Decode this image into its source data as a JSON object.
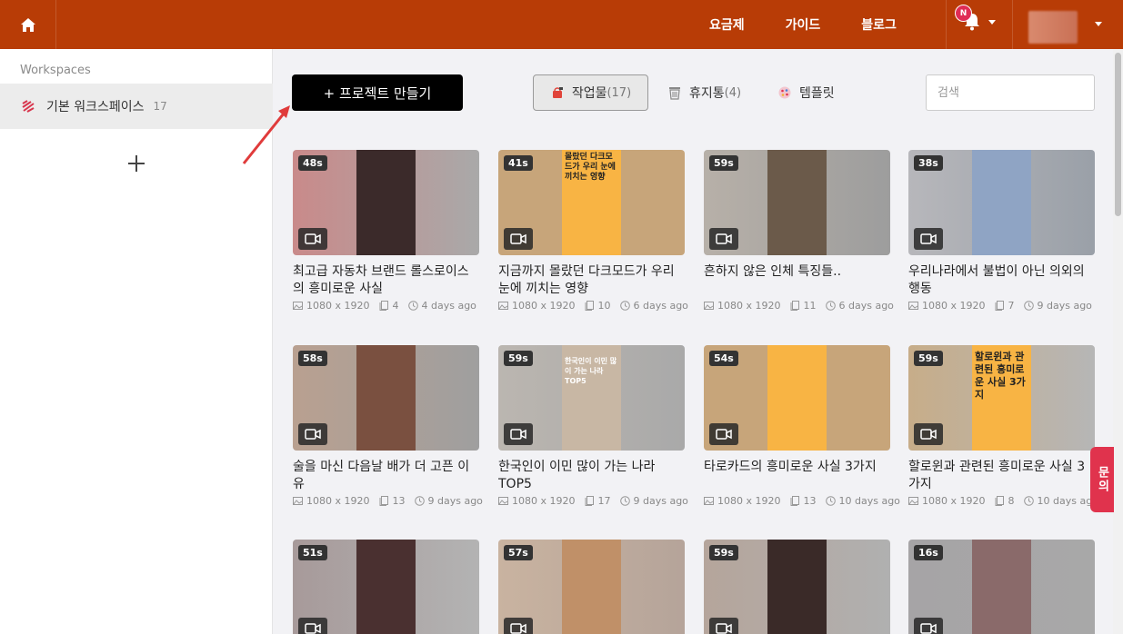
{
  "topbar": {
    "nav": [
      "요금제",
      "가이드",
      "블로그"
    ],
    "notification_badge": "N",
    "colors": {
      "bar": "#b83c06"
    }
  },
  "sidebar": {
    "title": "Workspaces",
    "workspace": {
      "label": "기본 워크스페이스",
      "count": "17"
    }
  },
  "toolbar": {
    "create_label": "+ 프로젝트 만들기",
    "filters": [
      {
        "label": "작업물",
        "count": "(17)",
        "icon": "folder-icon"
      },
      {
        "label": "휴지통",
        "count": "(4)",
        "icon": "trash-icon"
      },
      {
        "label": "템플릿",
        "count": "",
        "icon": "template-icon"
      }
    ],
    "search_placeholder": "검색"
  },
  "cards": [
    {
      "duration": "48s",
      "title": "최고급 자동차 브랜드 롤스로이스의 흥미로운 사실",
      "resolution": "1080 x 1920",
      "pages": "4",
      "time": "4 days ago"
    },
    {
      "duration": "41s",
      "title": "지금까지 몰랐던 다크모드가 우리 눈에 끼치는 영향",
      "resolution": "1080 x 1920",
      "pages": "10",
      "time": "6 days ago"
    },
    {
      "duration": "59s",
      "title": "흔하지 않은 인체 특징들..",
      "resolution": "1080 x 1920",
      "pages": "11",
      "time": "6 days ago"
    },
    {
      "duration": "38s",
      "title": "우리나라에서 불법이 아닌 의외의 행동",
      "resolution": "1080 x 1920",
      "pages": "7",
      "time": "9 days ago"
    },
    {
      "duration": "58s",
      "title": "술을 마신 다음날 배가 더 고픈 이유",
      "resolution": "1080 x 1920",
      "pages": "13",
      "time": "9 days ago"
    },
    {
      "duration": "59s",
      "title": "한국인이 이민 많이 가는 나라 TOP5",
      "resolution": "1080 x 1920",
      "pages": "17",
      "time": "9 days ago"
    },
    {
      "duration": "54s",
      "title": "타로카드의 흥미로운 사실 3가지",
      "resolution": "1080 x 1920",
      "pages": "13",
      "time": "10 days ago"
    },
    {
      "duration": "59s",
      "title": "할로윈과 관련된 흥미로운 사실 3가지",
      "resolution": "1080 x 1920",
      "pages": "8",
      "time": "10 days ago"
    },
    {
      "duration": "51s"
    },
    {
      "duration": "57s"
    },
    {
      "duration": "59s"
    },
    {
      "duration": "16s"
    }
  ],
  "thumb_texts": {
    "card2": "몰랐던 다크모드가 우리 눈에 끼치는 영향",
    "card6": "한국인이 이민 많이 가는 나라 TOP5",
    "card8": "할로윈과 관련된 흥미로운 사실 3가지"
  },
  "inquiry": "문의"
}
